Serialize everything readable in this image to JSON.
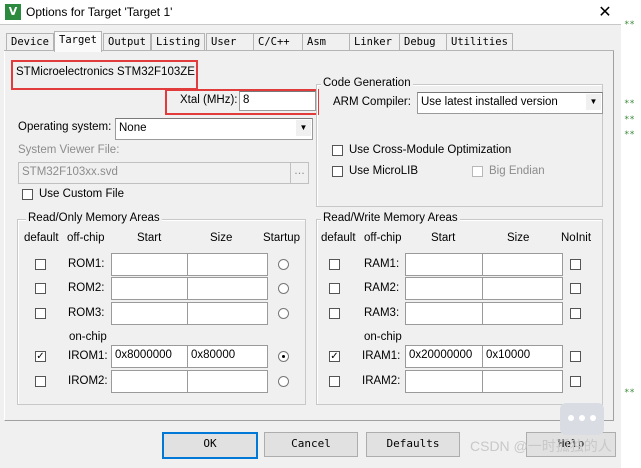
{
  "window": {
    "title": "Options for Target 'Target 1'",
    "icon_name": "uvision-logo-icon",
    "icon_glyph": "V",
    "close_glyph": "✕"
  },
  "tabs": [
    {
      "label": "Device"
    },
    {
      "label": "Target"
    },
    {
      "label": "Output"
    },
    {
      "label": "Listing"
    },
    {
      "label": "User"
    },
    {
      "label": "C/C++"
    },
    {
      "label": "Asm"
    },
    {
      "label": "Linker"
    },
    {
      "label": "Debug"
    },
    {
      "label": "Utilities"
    }
  ],
  "active_tab": "Target",
  "device": {
    "name": "STMicroelectronics STM32F103ZE"
  },
  "xtal": {
    "label": "Xtal (MHz):",
    "value": "8"
  },
  "os": {
    "label": "Operating system:",
    "value": "None"
  },
  "svf": {
    "label": "System Viewer File:",
    "value": "STM32F103xx.svd",
    "browse": "...",
    "custom_label": "Use Custom File",
    "custom_checked": false
  },
  "codegen": {
    "title": "Code Generation",
    "compiler_label": "ARM Compiler:",
    "compiler_value": "Use latest installed version",
    "cross_module": "Use Cross-Module Optimization",
    "microlib": "Use MicroLIB",
    "big_endian": "Big Endian"
  },
  "ro_memory": {
    "title": "Read/Only Memory Areas",
    "headers": {
      "default": "default",
      "offchip": "off-chip",
      "start": "Start",
      "size": "Size",
      "startup": "Startup"
    },
    "onchip_label": "on-chip",
    "rows": [
      {
        "name": "ROM1:",
        "start": "",
        "size": "",
        "default": false,
        "startup": false
      },
      {
        "name": "ROM2:",
        "start": "",
        "size": "",
        "default": false,
        "startup": false
      },
      {
        "name": "ROM3:",
        "start": "",
        "size": "",
        "default": false,
        "startup": false
      },
      {
        "name": "IROM1:",
        "start": "0x8000000",
        "size": "0x80000",
        "default": true,
        "startup": true
      },
      {
        "name": "IROM2:",
        "start": "",
        "size": "",
        "default": false,
        "startup": false
      }
    ]
  },
  "rw_memory": {
    "title": "Read/Write Memory Areas",
    "headers": {
      "default": "default",
      "offchip": "off-chip",
      "start": "Start",
      "size": "Size",
      "noinit": "NoInit"
    },
    "onchip_label": "on-chip",
    "rows": [
      {
        "name": "RAM1:",
        "start": "",
        "size": "",
        "default": false,
        "noinit": false
      },
      {
        "name": "RAM2:",
        "start": "",
        "size": "",
        "default": false,
        "noinit": false
      },
      {
        "name": "RAM3:",
        "start": "",
        "size": "",
        "default": false,
        "noinit": false
      },
      {
        "name": "IRAM1:",
        "start": "0x20000000",
        "size": "0x10000",
        "default": true,
        "noinit": false
      },
      {
        "name": "IRAM2:",
        "start": "",
        "size": "",
        "default": false,
        "noinit": false
      }
    ]
  },
  "buttons": {
    "ok": "OK",
    "cancel": "Cancel",
    "defaults": "Defaults",
    "help": "Help"
  },
  "watermark": "CSDN @一时孤独的人",
  "colors": {
    "highlight_red": "#e23b3b",
    "default_button_border": "#0078d7"
  },
  "check_glyph": "✓",
  "combo_glyph": "▼",
  "edge_marks": [
    "**",
    "**",
    "**",
    "**",
    "**"
  ]
}
